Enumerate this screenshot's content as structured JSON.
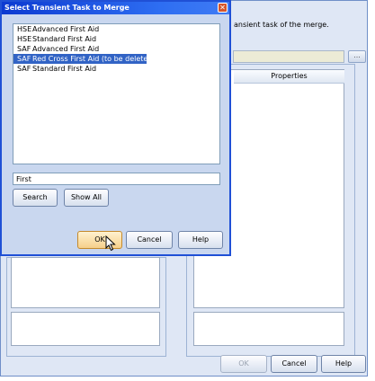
{
  "background_dialog": {
    "description": "ansient task of the merge.",
    "browse_label": "...",
    "properties_header": "Properties",
    "buttons": {
      "ok": "OK",
      "cancel": "Cancel",
      "help": "Help"
    }
  },
  "modal": {
    "title": "Select Transient Task to Merge",
    "close_symbol": "✕",
    "tasks": [
      {
        "code": "HSE",
        "name": "Advanced First Aid",
        "selected": false
      },
      {
        "code": "HSE",
        "name": "Standard First Aid",
        "selected": false
      },
      {
        "code": "SAF",
        "name": "Advanced First Aid",
        "selected": false
      },
      {
        "code": "SAF",
        "name": "Red Cross First Aid (to be deleted)",
        "selected": true
      },
      {
        "code": "SAF",
        "name": "Standard First Aid",
        "selected": false
      }
    ],
    "search_value": "First",
    "buttons": {
      "search": "Search",
      "show_all": "Show All",
      "ok": "OK",
      "cancel": "Cancel",
      "help": "Help"
    }
  }
}
